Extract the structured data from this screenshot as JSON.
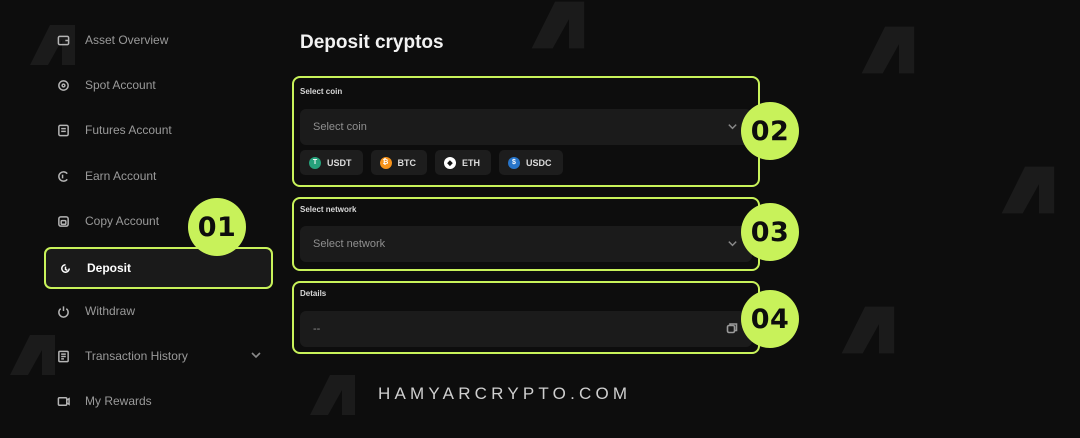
{
  "sidebar": {
    "items": [
      {
        "label": "Asset Overview",
        "icon": "wallet-icon"
      },
      {
        "label": "Spot Account",
        "icon": "spot-icon"
      },
      {
        "label": "Futures Account",
        "icon": "futures-icon"
      },
      {
        "label": "Earn Account",
        "icon": "earn-icon"
      },
      {
        "label": "Copy Account",
        "icon": "copy-icon"
      },
      {
        "label": "Deposit",
        "icon": "deposit-icon"
      },
      {
        "label": "Withdraw",
        "icon": "withdraw-icon"
      },
      {
        "label": "Transaction History",
        "icon": "history-icon"
      },
      {
        "label": "My Rewards",
        "icon": "rewards-icon"
      }
    ]
  },
  "badges": {
    "b1": "01",
    "b2": "02",
    "b3": "03",
    "b4": "04"
  },
  "main": {
    "title": "Deposit cryptos",
    "select_coin": {
      "label": "Select coin",
      "placeholder": "Select coin",
      "coins": [
        {
          "symbol": "USDT",
          "color": "#26a17b"
        },
        {
          "symbol": "BTC",
          "color": "#f7931a"
        },
        {
          "symbol": "ETH",
          "color": "#ffffff"
        },
        {
          "symbol": "USDC",
          "color": "#2775ca"
        }
      ]
    },
    "select_network": {
      "label": "Select network",
      "placeholder": "Select network"
    },
    "details": {
      "label": "Details",
      "value": "--"
    }
  },
  "footer": "HAMYARCRYPTO.COM",
  "colors": {
    "accent": "#c8f25a",
    "background": "#0d0d0d",
    "field": "#1b1b1b"
  }
}
